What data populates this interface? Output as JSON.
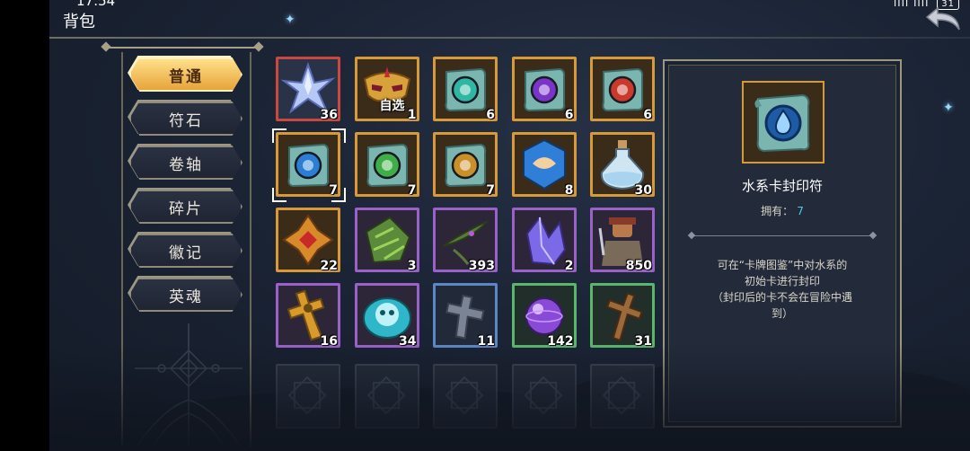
{
  "status": {
    "time": "17:54",
    "signal": "ııll",
    "wifi": "ııll",
    "battery": "31"
  },
  "page": {
    "title": "背包"
  },
  "tabs": [
    {
      "label": "普通",
      "active": true
    },
    {
      "label": "符石",
      "active": false
    },
    {
      "label": "卷轴",
      "active": false
    },
    {
      "label": "碎片",
      "active": false
    },
    {
      "label": "徽记",
      "active": false
    },
    {
      "label": "英魂",
      "active": false
    }
  ],
  "grid": [
    {
      "name": "crystal-star",
      "count": "36",
      "rarity": "red",
      "icon": "shard-icon"
    },
    {
      "name": "mask-selector",
      "count": "1",
      "rarity": "gold",
      "icon": "mask-icon",
      "tag": "自选"
    },
    {
      "name": "scroll-teal",
      "count": "6",
      "rarity": "gold",
      "icon": "scroll-icon",
      "seal": "#2fb7a3"
    },
    {
      "name": "scroll-purple",
      "count": "6",
      "rarity": "gold",
      "icon": "scroll-icon",
      "seal": "#7a34c7"
    },
    {
      "name": "scroll-red",
      "count": "6",
      "rarity": "gold",
      "icon": "scroll-icon",
      "seal": "#c93a2a"
    },
    {
      "name": "scroll-water",
      "count": "7",
      "rarity": "gold",
      "icon": "scroll-icon",
      "seal": "#2a7fd4",
      "selected": true
    },
    {
      "name": "scroll-leaf",
      "count": "7",
      "rarity": "gold",
      "icon": "scroll-icon",
      "seal": "#3fae48"
    },
    {
      "name": "scroll-earth",
      "count": "7",
      "rarity": "gold",
      "icon": "scroll-icon",
      "seal": "#c9902a"
    },
    {
      "name": "blue-gem",
      "count": "8",
      "rarity": "gold",
      "icon": "gem-icon"
    },
    {
      "name": "potion-bottle",
      "count": "30",
      "rarity": "gold",
      "icon": "potion-icon"
    },
    {
      "name": "gold-star-relic",
      "count": "22",
      "rarity": "gold",
      "icon": "relic-icon"
    },
    {
      "name": "green-ore",
      "count": "3",
      "rarity": "purple",
      "icon": "ore-icon"
    },
    {
      "name": "herb-leaf",
      "count": "393",
      "rarity": "purple",
      "icon": "herb-icon"
    },
    {
      "name": "purple-crystal",
      "count": "2",
      "rarity": "purple",
      "icon": "crystal-icon"
    },
    {
      "name": "hero-figure",
      "count": "850",
      "rarity": "purple",
      "icon": "hero-icon"
    },
    {
      "name": "golden-cross",
      "count": "16",
      "rarity": "purple",
      "icon": "cross-icon"
    },
    {
      "name": "skull-coin",
      "count": "34",
      "rarity": "purple",
      "icon": "skull-coin-icon"
    },
    {
      "name": "stone-cross",
      "count": "11",
      "rarity": "blue",
      "icon": "stone-cross-icon"
    },
    {
      "name": "purple-orb",
      "count": "142",
      "rarity": "green",
      "icon": "orb-icon"
    },
    {
      "name": "wood-cross",
      "count": "31",
      "rarity": "green",
      "icon": "wood-cross-icon"
    },
    {
      "name": "empty",
      "count": "",
      "rarity": "empty"
    },
    {
      "name": "empty",
      "count": "",
      "rarity": "empty"
    },
    {
      "name": "empty",
      "count": "",
      "rarity": "empty"
    },
    {
      "name": "empty",
      "count": "",
      "rarity": "empty"
    },
    {
      "name": "empty",
      "count": "",
      "rarity": "empty"
    }
  ],
  "rarity_colors": {
    "red": "#c94a3c",
    "gold": "#d89a38",
    "purple": "#9a62c8",
    "blue": "#5a88c4",
    "green": "#5ab66a",
    "empty": "#4a5060"
  },
  "detail": {
    "name": "水系卡封印符",
    "own_label": "拥有：",
    "own_value": "7",
    "desc_lines": [
      "可在“卡牌图鉴”中对水系的",
      "初始卡进行封印",
      "（封印后的卡不会在冒险中遇",
      "到）"
    ]
  }
}
